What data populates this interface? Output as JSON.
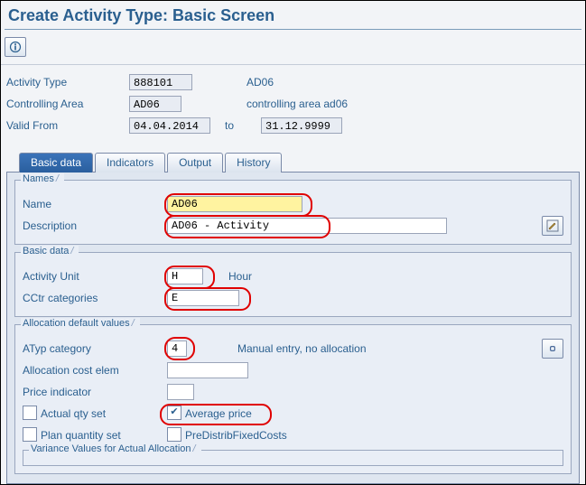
{
  "page": {
    "title": "Create Activity Type: Basic Screen"
  },
  "toolbar": {
    "info_icon": "info"
  },
  "header": {
    "activity_type": {
      "label": "Activity Type",
      "value": "888101",
      "text": "AD06"
    },
    "controlling_area": {
      "label": "Controlling Area",
      "value": "AD06",
      "text": "controlling area ad06"
    },
    "valid_from": {
      "label": "Valid From",
      "value": "04.04.2014"
    },
    "to": {
      "label": "to",
      "value": "31.12.9999"
    }
  },
  "tabs": [
    {
      "key": "basic",
      "label": "Basic data",
      "selected": true
    },
    {
      "key": "indicators",
      "label": "Indicators",
      "selected": false
    },
    {
      "key": "output",
      "label": "Output",
      "selected": false
    },
    {
      "key": "history",
      "label": "History",
      "selected": false
    }
  ],
  "groups": {
    "names": {
      "title": "Names",
      "name": {
        "label": "Name",
        "value": "AD06"
      },
      "description": {
        "label": "Description",
        "value": "AD06 - Activity"
      },
      "long_text_icon": "pencil"
    },
    "basic": {
      "title": "Basic data",
      "unit": {
        "label": "Activity Unit",
        "value": "H",
        "text": "Hour"
      },
      "cctr": {
        "label": "CCtr categories",
        "value": "E"
      }
    },
    "alloc": {
      "title": "Allocation default values",
      "atyp": {
        "label": "ATyp category",
        "value": "4",
        "text": "Manual entry, no allocation"
      },
      "cost_elem": {
        "label": "Allocation cost elem",
        "value": ""
      },
      "price_ind": {
        "label": "Price indicator",
        "value": ""
      },
      "actual_qty": {
        "label": "Actual qty set",
        "checked": false
      },
      "avg_price": {
        "label": "Average price",
        "checked": true
      },
      "plan_qty": {
        "label": "Plan quantity set",
        "checked": false
      },
      "predist": {
        "label": "PreDistribFixedCosts",
        "checked": false
      },
      "variance_title": "Variance Values for Actual Allocation",
      "link_icon": "chain"
    }
  }
}
